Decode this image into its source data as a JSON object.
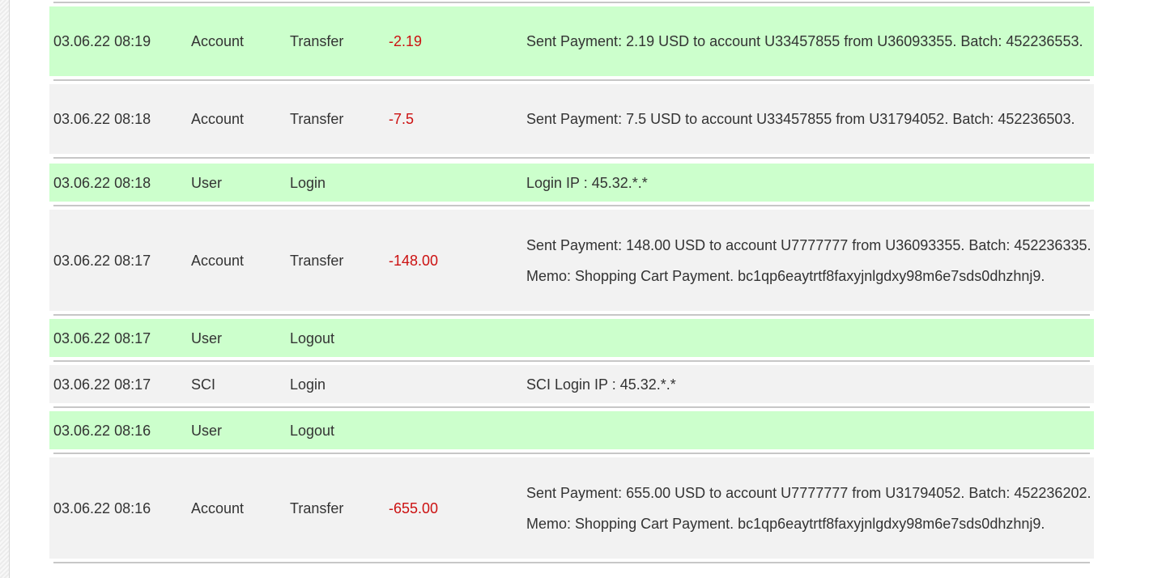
{
  "rows": [
    {
      "date": "03.06.22 08:19",
      "category": "Account",
      "action": "Transfer",
      "amount": "-2.19",
      "description": "Sent Payment: 2.19 USD to account U33457855 from U36093355. Batch: 452236553."
    },
    {
      "date": "03.06.22 08:18",
      "category": "Account",
      "action": "Transfer",
      "amount": "-7.5",
      "description": "Sent Payment: 7.5 USD to account U33457855 from U31794052. Batch: 452236503."
    },
    {
      "date": "03.06.22 08:18",
      "category": "User",
      "action": "Login",
      "amount": "",
      "description": "Login IP : 45.32.*.*"
    },
    {
      "date": "03.06.22 08:17",
      "category": "Account",
      "action": "Transfer",
      "amount": "-148.00",
      "description": "Sent Payment: 148.00 USD to account U7777777 from U36093355. Batch: 452236335. Memo: Shopping Cart Payment. bc1qp6eaytrtf8faxyjnlgdxy98m6e7sds0dhzhnj9."
    },
    {
      "date": "03.06.22 08:17",
      "category": "User",
      "action": "Logout",
      "amount": "",
      "description": ""
    },
    {
      "date": "03.06.22 08:17",
      "category": "SCI",
      "action": "Login",
      "amount": "",
      "description": "SCI Login IP : 45.32.*.*"
    },
    {
      "date": "03.06.22 08:16",
      "category": "User",
      "action": "Logout",
      "amount": "",
      "description": ""
    },
    {
      "date": "03.06.22 08:16",
      "category": "Account",
      "action": "Transfer",
      "amount": "-655.00",
      "description": "Sent Payment: 655.00 USD to account U7777777 from U31794052. Batch: 452236202. Memo: Shopping Cart Payment. bc1qp6eaytrtf8faxyjnlgdxy98m6e7sds0dhzhnj9."
    }
  ],
  "colors": {
    "row_green": "#ccffcc",
    "row_gray": "#f2f2f2",
    "amount_negative": "#cc1111"
  }
}
